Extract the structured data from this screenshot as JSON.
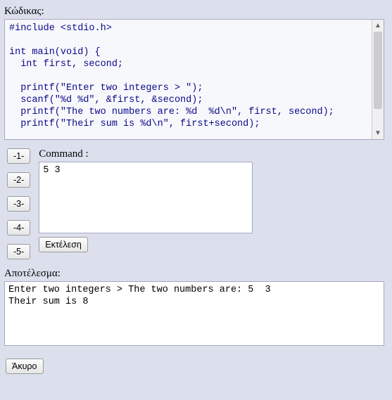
{
  "labels": {
    "code": "Κώδικας:",
    "command": "Command :",
    "result": "Αποτέλεσμα:"
  },
  "code": "#include <stdio.h>\n\nint main(void) {\n  int first, second;\n\n  printf(\"Enter two integers > \");\n  scanf(\"%d %d\", &first, &second);\n  printf(\"The two numbers are: %d  %d\\n\", first, second);\n  printf(\"Their sum is %d\\n\", first+second);",
  "num_buttons": [
    "-1-",
    "-2-",
    "-3-",
    "-4-",
    "-5-"
  ],
  "command_input": "5 3",
  "buttons": {
    "execute": "Εκτέλεση",
    "cancel": "Άκυρο"
  },
  "result": "Enter two integers > The two numbers are: 5  3\nTheir sum is 8"
}
